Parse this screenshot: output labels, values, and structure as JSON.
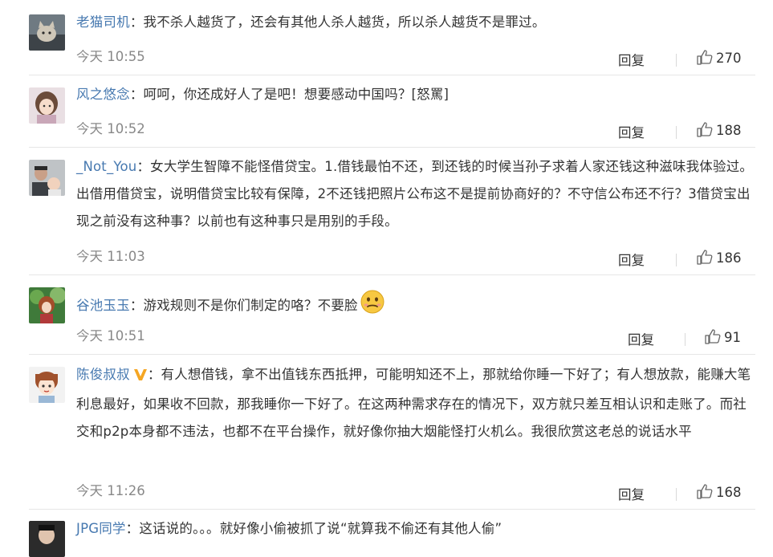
{
  "comments": [
    {
      "user": "老猫司机",
      "separator": "：",
      "text": "我不杀人越货了，还会有其他人杀人越货，所以杀人越货不是罪过。",
      "time": "今天 10:55",
      "reply_label": "回复",
      "likes": "270",
      "avatar_icon": "cat-photo"
    },
    {
      "user": "风之悠念",
      "separator": "：",
      "text": "呵呵，你还成好人了是吧！想要感动中国吗？[怒罵]",
      "time": "今天 10:52",
      "reply_label": "回复",
      "likes": "188",
      "avatar_icon": "anime-girl"
    },
    {
      "user": "_Not_You",
      "separator": "：",
      "text": "女大学生智障不能怪借贷宝。1.借钱最怕不还，到还钱的时候当孙子求着人家还钱这种滋味我体验过。出借用借贷宝，说明借贷宝比较有保障，2不还钱把照片公布这不是提前协商好的？不守信公布还不行？3借贷宝出现之前没有这种事？以前也有这种事只是用别的手段。",
      "time": "今天 11:03",
      "reply_label": "回复",
      "likes": "186",
      "avatar_icon": "man-with-baby"
    },
    {
      "user": "谷池玉玉",
      "separator": "：",
      "text": "游戏规则不是你们制定的咯？不要脸",
      "emoji": "pouting-emoji",
      "time": "今天 10:51",
      "reply_label": "回复",
      "likes": "91",
      "avatar_icon": "forest-girl"
    },
    {
      "user": "陈俊叔叔",
      "separator": "：",
      "verified": true,
      "badge_color": "#f5a623",
      "text": "有人想借钱，拿不出值钱东西抵押，可能明知还不上，那就给你睡一下好了；有人想放款，能赚大笔利息最好，如果收不回款，那我睡你一下好了。在这两种需求存在的情况下，双方就只差互相认识和走账了。而社交和p2p本身都不违法，也都不在平台操作，就好像你抽大烟能怪打火机么。我很欣赏这老总的说话水平",
      "time": "今天 11:26",
      "reply_label": "回复",
      "likes": "168",
      "avatar_icon": "cartoon-boy"
    },
    {
      "user": "JPG同学",
      "separator": "：",
      "text": "这话说的。。。就好像小偷被抓了说“就算我不偷还有其他人偷”",
      "avatar_icon": "man-photo"
    }
  ],
  "colors": {
    "username": "#4779b0",
    "text": "#333333",
    "time": "#888888",
    "divider": "#e6e6e6"
  }
}
